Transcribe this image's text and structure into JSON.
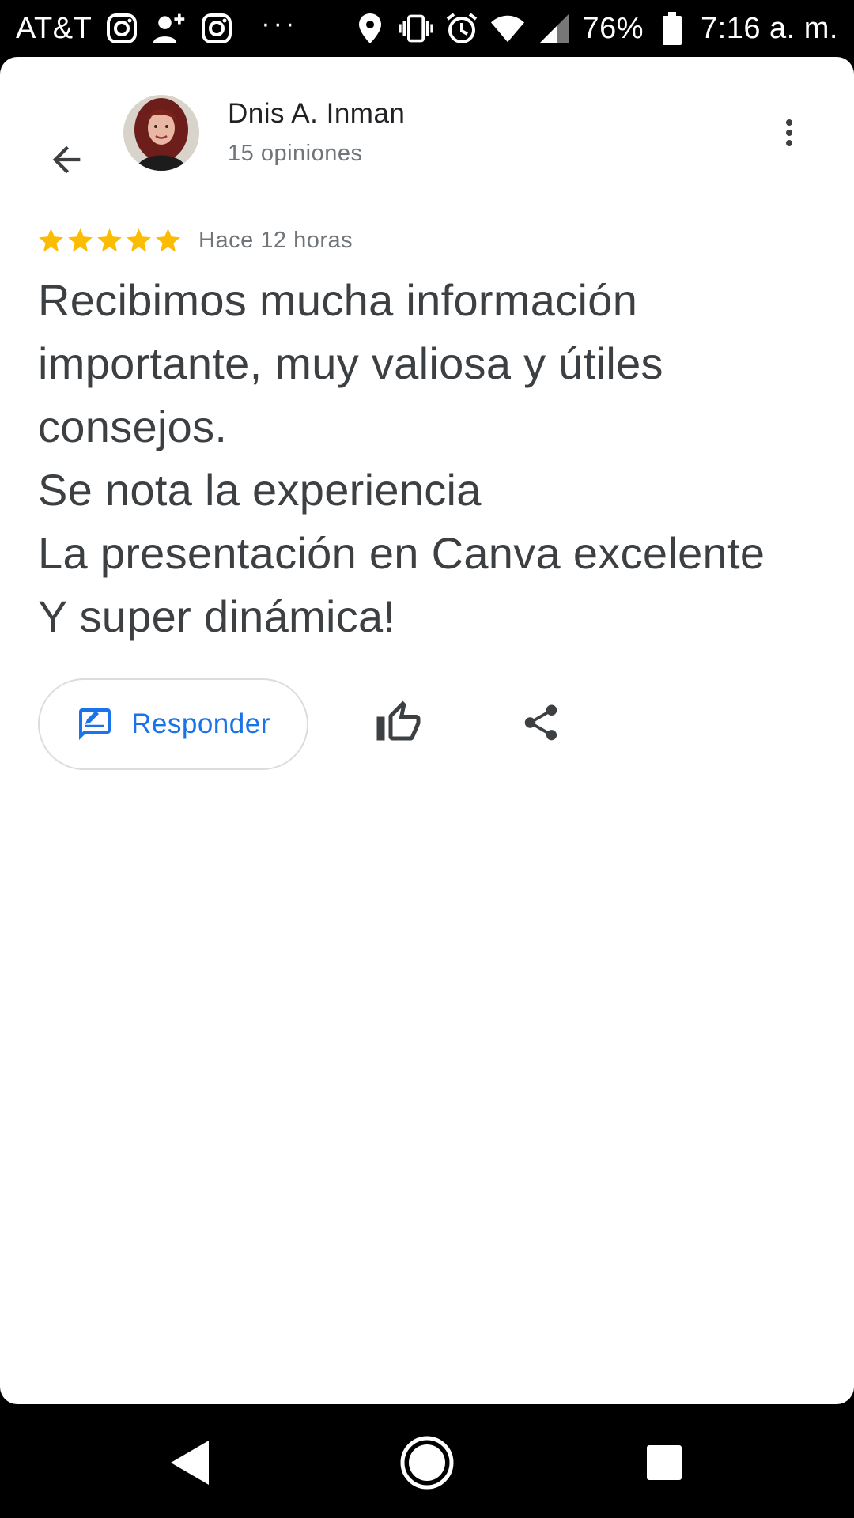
{
  "status_bar": {
    "carrier": "AT&T",
    "battery": "76%",
    "time": "7:16 a. m.",
    "icons": [
      "instagram-icon",
      "add-person-icon",
      "instagram-icon",
      "more-notifications-icon",
      "location-icon",
      "vibrate-icon",
      "alarm-icon",
      "wifi-icon",
      "signal-icon",
      "battery-icon"
    ]
  },
  "header": {
    "reviewer_name": "Dnis A. Inman",
    "reviews_count": "15 opiniones",
    "back_icon": "arrow-back-icon",
    "more_icon": "more-vert-icon"
  },
  "review": {
    "rating": 5,
    "max_rating": 5,
    "time_ago": "Hace 12 horas",
    "star_color": "#fbbc04",
    "lines": [
      "Recibimos mucha información",
      "importante, muy valiosa y útiles",
      "consejos.",
      "Se nota la experiencia",
      "La presentación en Canva excelente",
      "Y super dinámica!"
    ]
  },
  "actions": {
    "reply_label": "Responder",
    "reply_icon": "rate-review-icon",
    "like_icon": "thumb-up-icon",
    "share_icon": "share-icon",
    "accent_color": "#1a73e8"
  },
  "nav_bar": {
    "icons": [
      "nav-back-icon",
      "nav-home-icon",
      "nav-recents-icon"
    ]
  }
}
